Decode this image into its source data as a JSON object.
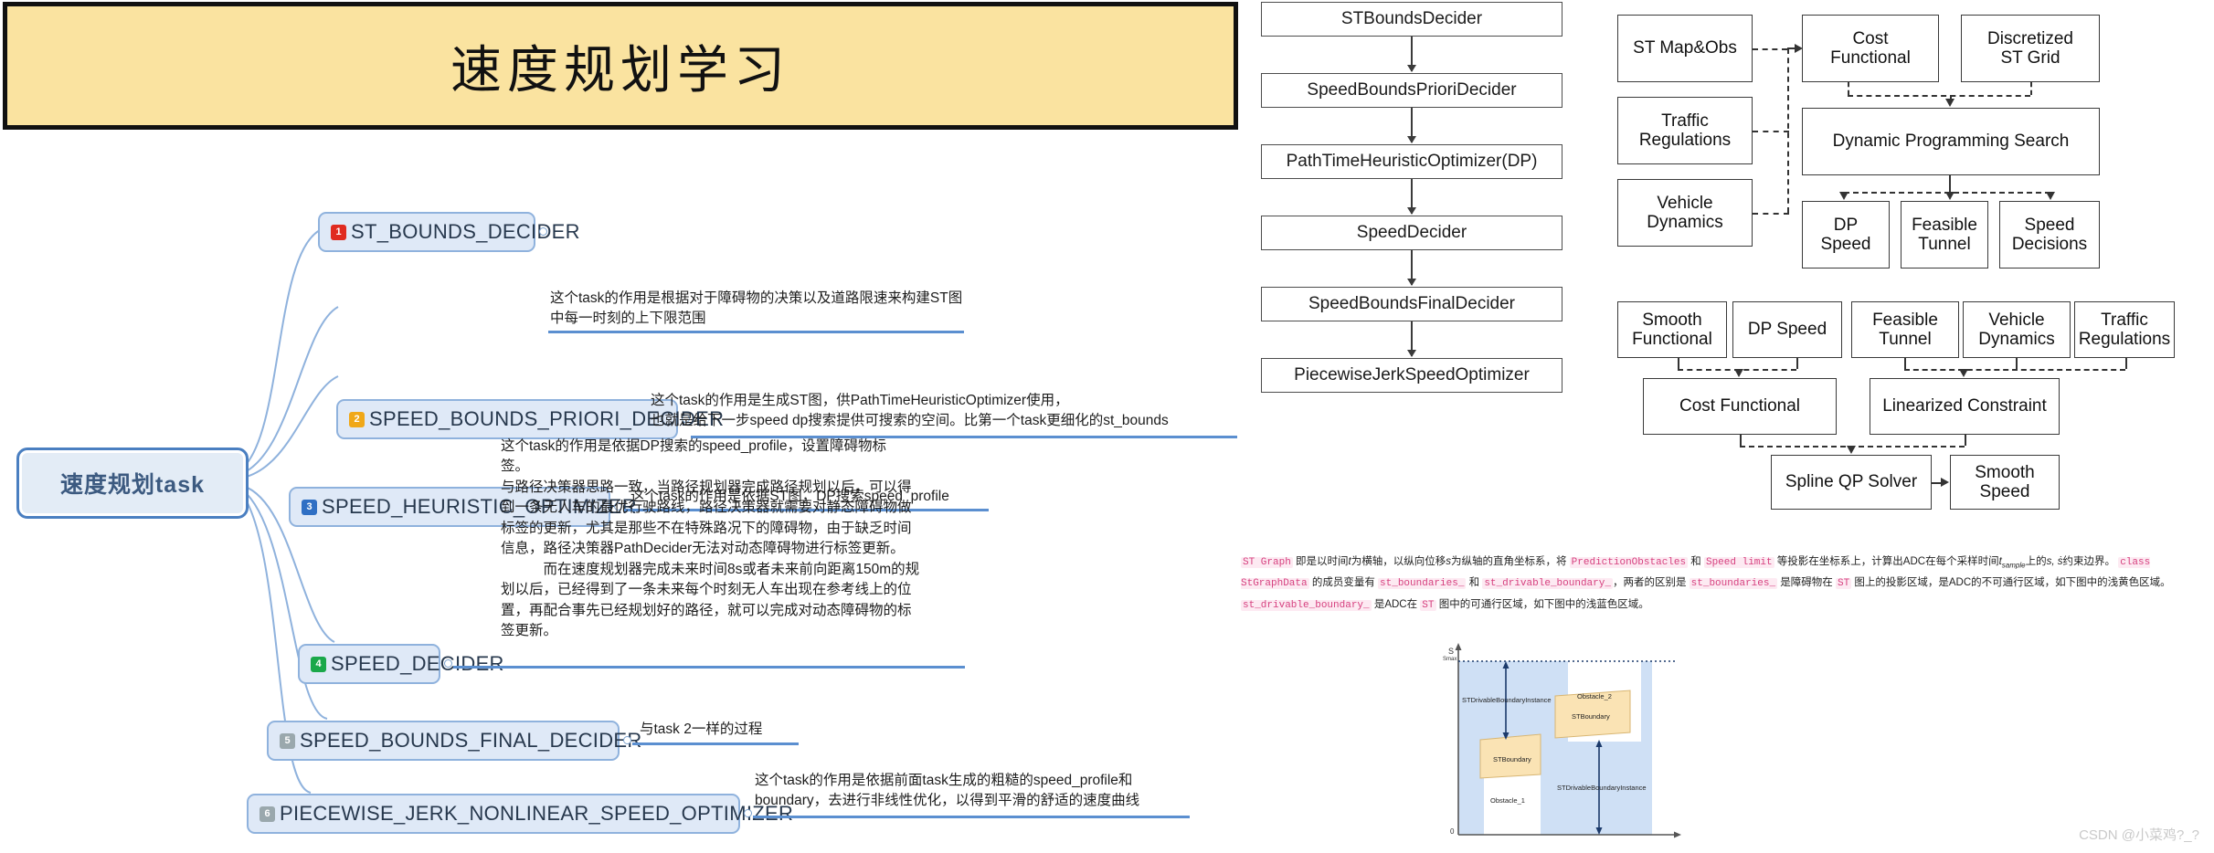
{
  "header": {
    "title": "速度规划学习"
  },
  "mindmap": {
    "root_label": "速度规划task",
    "nodes": [
      {
        "num": "1",
        "label": "ST_BOUNDS_DECIDER",
        "badge_color": "#e02b20"
      },
      {
        "num": "2",
        "label": "SPEED_BOUNDS_PRIORI_DECIDER",
        "badge_color": "#f0a818"
      },
      {
        "num": "3",
        "label": "SPEED_HEURISTIC_OPTIMIZER",
        "badge_color": "#2f6fc4"
      },
      {
        "num": "4",
        "label": "SPEED_DECIDER",
        "badge_color": "#1aa84a"
      },
      {
        "num": "5",
        "label": "SPEED_BOUNDS_FINAL_DECIDER",
        "badge_color": "#9aa8ad"
      },
      {
        "num": "6",
        "label": "PIECEWISE_JERK_NONLINEAR_SPEED_OPTIMIZER",
        "badge_color": "#9aa8ad"
      }
    ],
    "annotations": [
      {
        "lines": [
          "这个task的作用是根据对于障碍物的决策以及道路限速来构建ST图",
          "中每一时刻的上下限范围"
        ]
      },
      {
        "lines": [
          "这个task的作用是生成ST图，供PathTimeHeuristicOptimizer使用，",
          "也就是给下一步speed dp搜索提供可搜索的空间。比第一个task更细化的st_bounds"
        ]
      },
      {
        "lines": [
          "这个task的作用是依据ST图，DP搜索speed_profile"
        ]
      },
      {
        "lines": [
          "这个task的作用是依据DP搜索的speed_profile，设置障碍物标",
          "签。",
          "与路径决策器思路一致，当路径规划器完成路径规划以后，可以得",
          "到一条无人车的最优行驶路线，路径决策器就需要对静态障碍物做",
          "标签的更新，尤其是那些不在特殊路况下的障碍物，由于缺乏时间",
          "信息，路径决策器PathDecider无法对动态障碍物进行标签更新。",
          "　　　而在速度规划器完成未来时间8s或者未来前向距离150m的规",
          "划以后，已经得到了一条未来每个时刻无人车出现在参考线上的位",
          "置，再配合事先已经规划好的路径，就可以完成对动态障碍物的标",
          "签更新。"
        ]
      },
      {
        "lines": [
          "与task 2一样的过程"
        ]
      },
      {
        "lines": [
          "这个task的作用是依据前面task生成的粗糙的speed_profile和",
          "boundary，去进行非线性优化，以得到平滑的舒适的速度曲线"
        ]
      }
    ]
  },
  "flow_column": {
    "boxes": [
      "STBoundsDecider",
      "SpeedBoundsPrioriDecider",
      "PathTimeHeuristicOptimizer(DP)",
      "SpeedDecider",
      "SpeedBoundsFinalDecider",
      "PiecewiseJerkSpeedOptimizer"
    ]
  },
  "dp_diagram": {
    "inputs": [
      "ST Map&Obs",
      "Traffic\nRegulations",
      "Vehicle\nDynamics"
    ],
    "cost": "Cost\nFunctional",
    "grid": "Discretized\nST Grid",
    "search": "Dynamic Programming Search",
    "outputs": [
      "DP\nSpeed",
      "Feasible\nTunnel",
      "Speed\nDecisions"
    ]
  },
  "qp_diagram": {
    "top": [
      "Smooth\nFunctional",
      "DP Speed",
      "Feasible\nTunnel",
      "Vehicle\nDynamics",
      "Traffic\nRegulations"
    ],
    "mid": [
      "Cost Functional",
      "Linearized Constraint"
    ],
    "solver": "Spline QP Solver",
    "result": "Smooth\nSpeed"
  },
  "code_para": {
    "segments": [
      {
        "t": "ST Graph",
        "k": "code"
      },
      {
        "t": " 即是以时间",
        "k": "text"
      },
      {
        "t": "t",
        "k": "italic"
      },
      {
        "t": "为横轴，以纵向位移",
        "k": "text"
      },
      {
        "t": "s",
        "k": "italic"
      },
      {
        "t": "为纵轴的直角坐标系，将 ",
        "k": "text"
      },
      {
        "t": "PredictionObstacles",
        "k": "code"
      },
      {
        "t": " 和 ",
        "k": "text"
      },
      {
        "t": "Speed limit",
        "k": "code"
      },
      {
        "t": " 等投影在坐标系上，计算出ADC在每个采样时间",
        "k": "text"
      },
      {
        "t": "t",
        "k": "italic"
      },
      {
        "t": "sample",
        "k": "sub"
      },
      {
        "t": "上的",
        "k": "text"
      },
      {
        "t": "s, ṡ",
        "k": "italic"
      },
      {
        "t": "约束边界。 ",
        "k": "text"
      },
      {
        "t": "class StGraphData",
        "k": "code"
      },
      {
        "t": " 的成员变量有 ",
        "k": "text"
      },
      {
        "t": "st_boundaries_",
        "k": "code"
      },
      {
        "t": " 和 ",
        "k": "text"
      },
      {
        "t": "st_drivable_boundary_",
        "k": "code"
      },
      {
        "t": "，两者的区别是 ",
        "k": "text"
      },
      {
        "t": "st_boundaries_",
        "k": "code"
      },
      {
        "t": " 是障碍物在 ",
        "k": "text"
      },
      {
        "t": "ST",
        "k": "code"
      },
      {
        "t": " 图上的投影区域，是ADC的不可通行区域，如下图中的浅黄色区域。 ",
        "k": "text"
      },
      {
        "t": "st_drivable_boundary_",
        "k": "code"
      },
      {
        "t": " 是ADC在 ",
        "k": "text"
      },
      {
        "t": "ST",
        "k": "code"
      },
      {
        "t": " 图中的可通行区域，如下图中的浅蓝色区域。",
        "k": "text"
      }
    ]
  },
  "st_graph": {
    "y_axis_label": "S",
    "y_max_label": "Smax",
    "y_zero_label": "0",
    "obstacle_1": "Obstacle_1",
    "obstacle_2": "Obstacle_2",
    "boundary_label_1": "STBoundary",
    "boundary_label_2": "STBoundary",
    "drivable_label_1": "STDrivableBoundaryInstance",
    "drivable_label_2": "STDrivableBoundaryInstance",
    "drivable_color": "#cfe0f5",
    "boundary_color": "#fae3b4"
  },
  "watermark": {
    "text": "CSDN @小菜鸡?_?"
  }
}
